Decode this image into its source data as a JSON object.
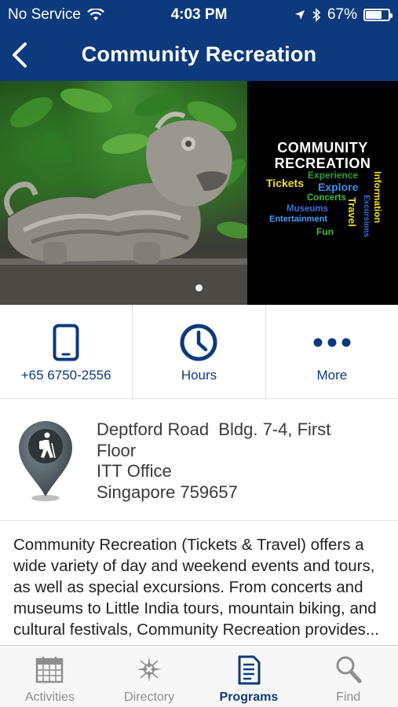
{
  "status_bar": {
    "carrier": "No Service",
    "time": "4:03 PM",
    "battery": "67%"
  },
  "nav": {
    "title": "Community Recreation"
  },
  "hero": {
    "poster_title_1": "COMMUNITY",
    "poster_title_2": "RECREATION",
    "words": {
      "experience": "Experience",
      "tickets": "Tickets",
      "explore": "Explore",
      "concerts": "Concerts",
      "museums": "Museums",
      "entertainment": "Entertainment",
      "fun": "Fun",
      "travel": "Travel",
      "excursions": "Excursions",
      "information": "Information"
    },
    "page_count": 1
  },
  "actions": {
    "phone_label": "+65 6750-2556",
    "hours_label": "Hours",
    "more_label": "More"
  },
  "address": {
    "line1": "Deptford Road  Bldg. 7-4, First",
    "line2": "Floor",
    "line3": "ITT Office",
    "line4": "Singapore 759657"
  },
  "description": {
    "text": "Community Recreation (Tickets & Travel) offers a wide variety of day and weekend events and tours, as well as special excursions. From concerts and museums to Little India tours, mountain biking, and cultural festivals, Community Recreation provides..."
  },
  "tabbar": {
    "activities": "Activities",
    "directory": "Directory",
    "programs": "Programs",
    "find": "Find"
  },
  "colors": {
    "brand": "#0d3a7d",
    "inactive": "#8e8e8e"
  }
}
